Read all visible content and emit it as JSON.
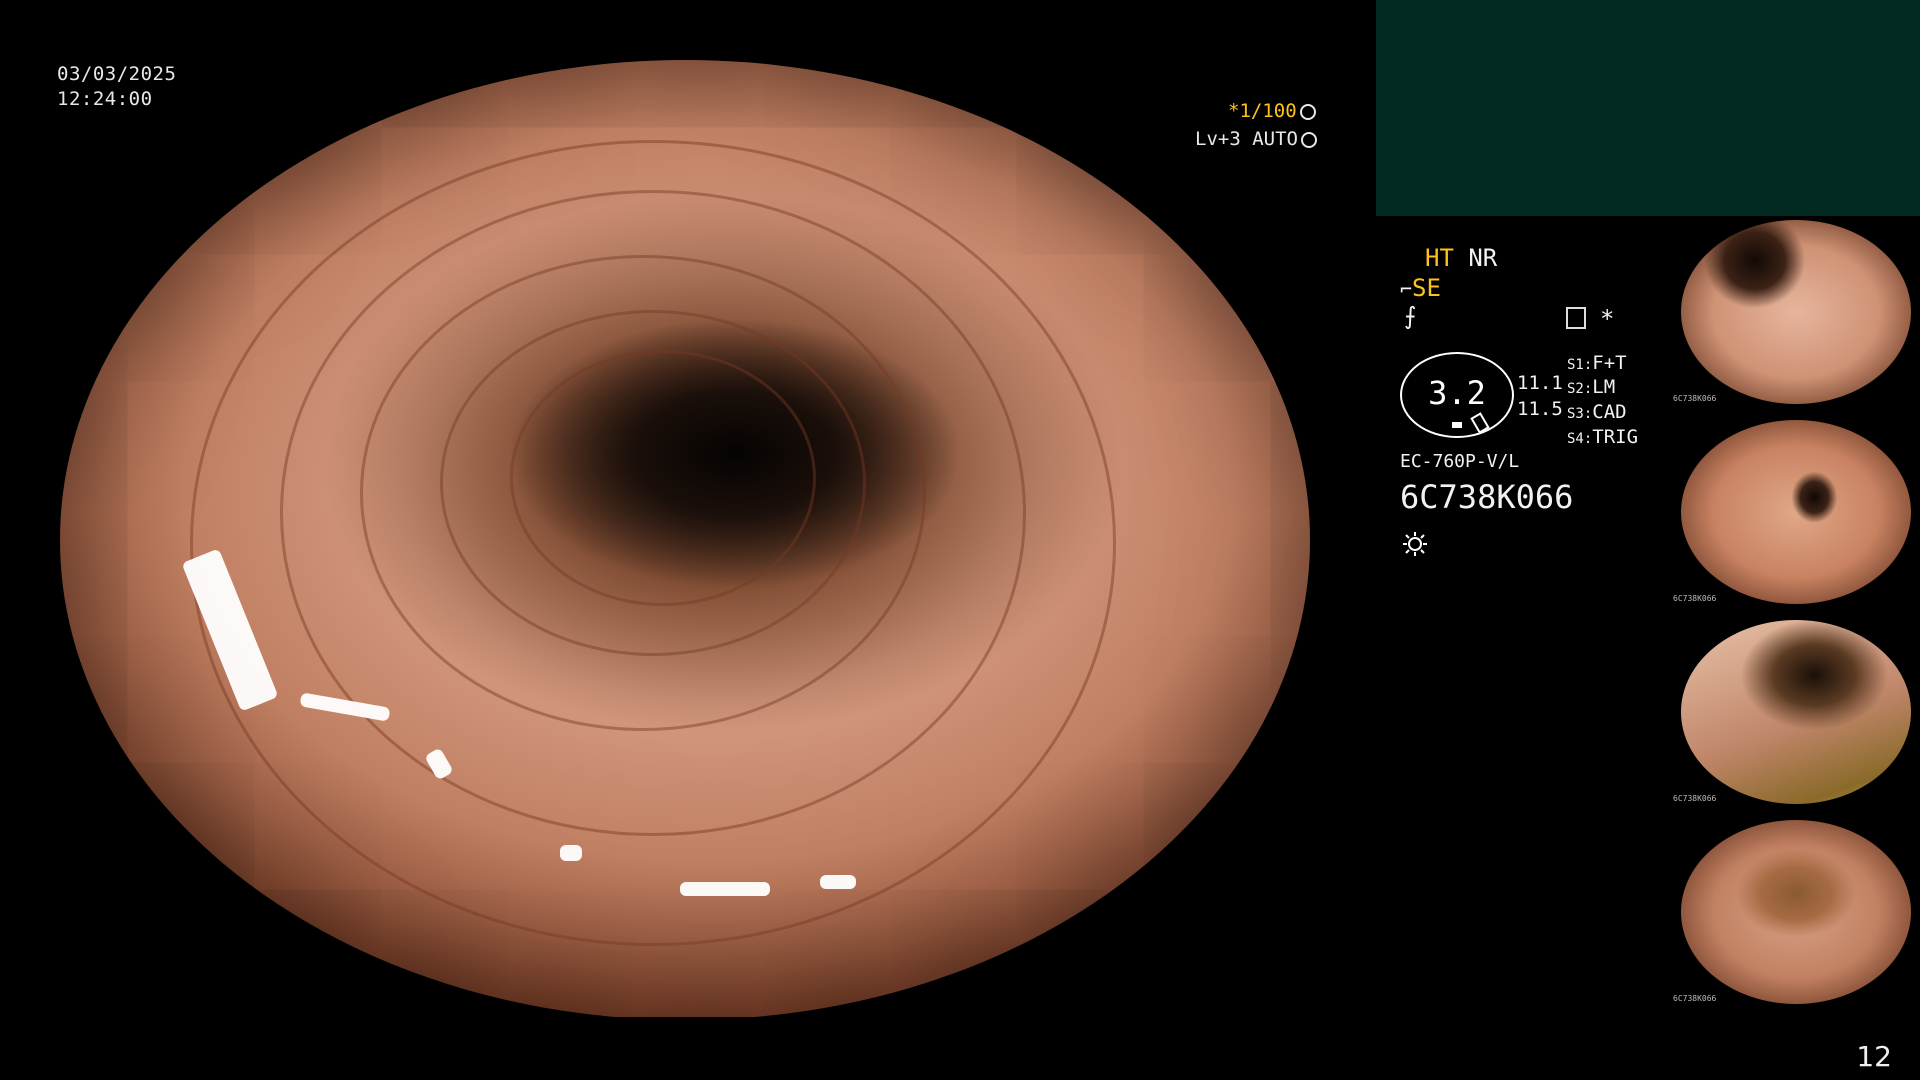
{
  "overlay": {
    "date": "03/03/2025",
    "time": "12:24:00",
    "shutter": "*1/100",
    "level": "Lv+3 AUTO"
  },
  "info_panel": {
    "ht": "HT",
    "nr": "NR",
    "se": "SE",
    "gauge_value": "3.2",
    "val_a": "11.1",
    "val_b": "11.5",
    "s1_key": "S1:",
    "s1_val": "F+T",
    "s2_key": "S2:",
    "s2_val": "LM",
    "s3_key": "S3:",
    "s3_val": "CAD",
    "s4_key": "S4:",
    "s4_val": "TRIG",
    "scope_model": "EC-760P-V/L",
    "serial": "6C738K066",
    "asterisk": "*"
  },
  "thumbnails": [
    {
      "label": "6C738K066"
    },
    {
      "label": "6C738K066"
    },
    {
      "label": "6C738K066"
    },
    {
      "label": "6C738K066"
    }
  ],
  "page_number": "12",
  "colors": {
    "panel_teal": "#032a22",
    "indicator_yellow": "#ffc21a"
  }
}
